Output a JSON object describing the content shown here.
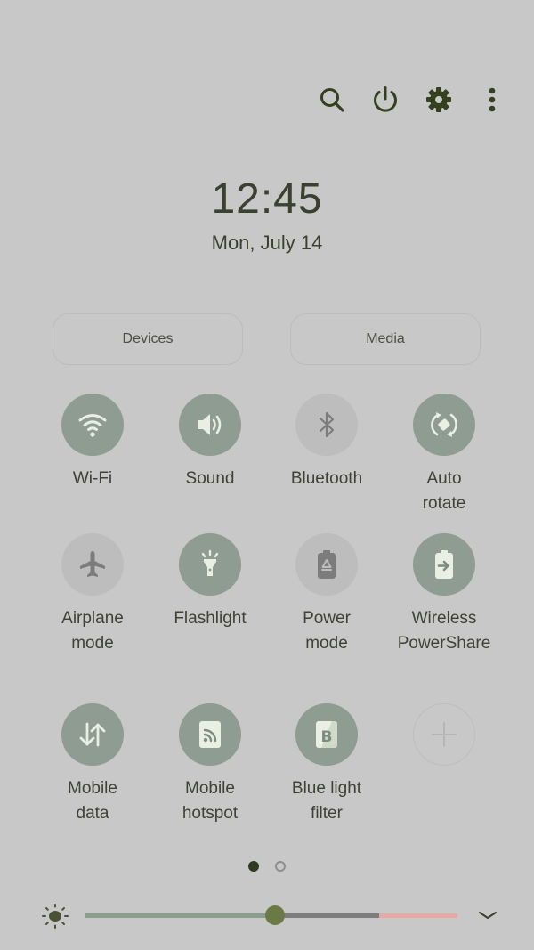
{
  "topbar": {
    "icons": [
      {
        "name": "search-icon",
        "label": "Search"
      },
      {
        "name": "power-icon",
        "label": "Power"
      },
      {
        "name": "gear-icon",
        "label": "Settings"
      },
      {
        "name": "more-vert-icon",
        "label": "More options"
      }
    ]
  },
  "clock": {
    "time": "12:45",
    "date": "Mon, July 14"
  },
  "shortcuts": {
    "devices_label": "Devices",
    "media_label": "Media"
  },
  "tiles": [
    {
      "label": "Wi-Fi",
      "icon": "wifi-icon",
      "state": "on"
    },
    {
      "label": "Sound",
      "icon": "volume-icon",
      "state": "on"
    },
    {
      "label": "Bluetooth",
      "icon": "bluetooth-icon",
      "state": "off"
    },
    {
      "label": "Auto\nrotate",
      "icon": "auto-rotate-icon",
      "state": "on"
    },
    {
      "label": "Airplane\nmode",
      "icon": "airplane-icon",
      "state": "off"
    },
    {
      "label": "Flashlight",
      "icon": "flashlight-icon",
      "state": "on"
    },
    {
      "label": "Power\nmode",
      "icon": "battery-recycle-icon",
      "state": "off"
    },
    {
      "label": "Wireless\nPowerShare",
      "icon": "battery-share-icon",
      "state": "on"
    },
    {
      "label": "Mobile\ndata",
      "icon": "data-arrows-icon",
      "state": "on"
    },
    {
      "label": "Mobile\nhotspot",
      "icon": "hotspot-icon",
      "state": "on"
    },
    {
      "label": "Blue light\nfilter",
      "icon": "blue-light-filter-icon",
      "state": "on"
    },
    {
      "label": "",
      "icon": "add-icon",
      "state": "add"
    }
  ],
  "pagination": {
    "total": 2,
    "current": 1
  },
  "brightness": {
    "level_percent": 51,
    "warning_from_percent": 79
  },
  "colors": {
    "background": "#c8c8c8",
    "tile_on": "#8e9c91",
    "tile_off": "#bdbdbd",
    "icon_on": "#e9efe2",
    "icon_off": "#7c7c7c",
    "accent_dark": "#3a4428",
    "slider_filled": "#8a9e8b",
    "slider_track": "#7d7d7d",
    "slider_warning": "#e6a9a3",
    "slider_thumb": "#6b7a45"
  }
}
